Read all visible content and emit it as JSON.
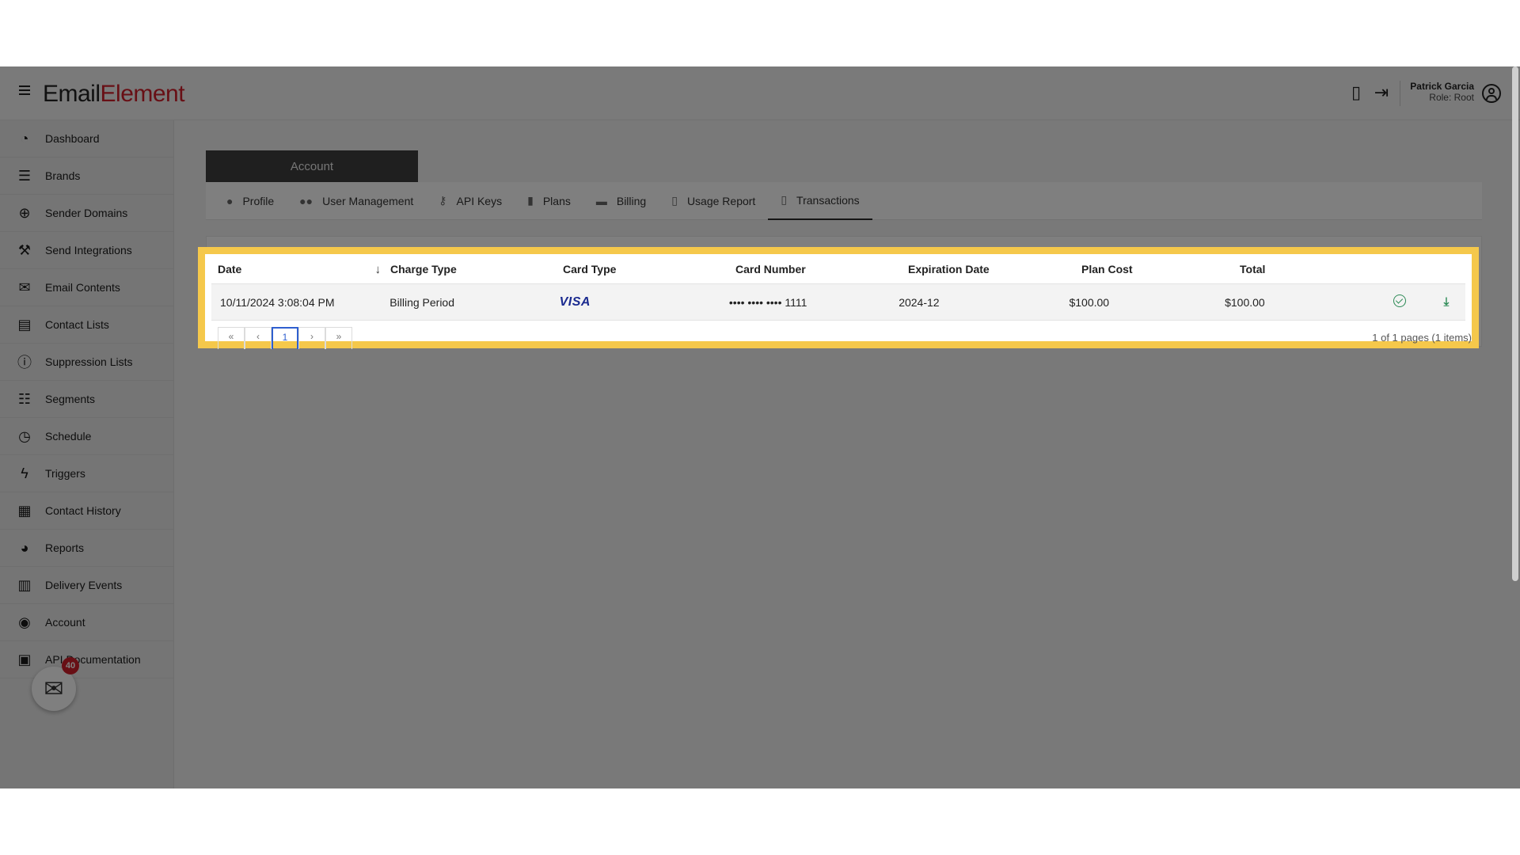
{
  "header": {
    "logo_part1": "Em",
    "logo_part2": "ail",
    "logo_part3": "Element",
    "user_name": "Patrick Garcia",
    "user_role": "Role: Root"
  },
  "sidebar": {
    "items": [
      {
        "label": "Dashboard",
        "icon": "dashboard-icon"
      },
      {
        "label": "Brands",
        "icon": "brands-icon"
      },
      {
        "label": "Sender Domains",
        "icon": "globe-icon"
      },
      {
        "label": "Send Integrations",
        "icon": "wrench-icon"
      },
      {
        "label": "Email Contents",
        "icon": "envelope-icon"
      },
      {
        "label": "Contact Lists",
        "icon": "book-icon"
      },
      {
        "label": "Suppression Lists",
        "icon": "alert-icon"
      },
      {
        "label": "Segments",
        "icon": "segments-icon"
      },
      {
        "label": "Schedule",
        "icon": "clock-icon"
      },
      {
        "label": "Triggers",
        "icon": "bolt-icon"
      },
      {
        "label": "Contact History",
        "icon": "clipboard-icon"
      },
      {
        "label": "Reports",
        "icon": "pie-chart-icon"
      },
      {
        "label": "Delivery Events",
        "icon": "bar-chart-icon"
      },
      {
        "label": "Account",
        "icon": "user-circle-icon"
      },
      {
        "label": "API Documentation",
        "icon": "document-icon"
      }
    ],
    "mail_badge": "40"
  },
  "account": {
    "section_title": "Account",
    "tabs": [
      {
        "label": "Profile",
        "icon": "person-icon"
      },
      {
        "label": "User Management",
        "icon": "users-icon"
      },
      {
        "label": "API Keys",
        "icon": "key-icon"
      },
      {
        "label": "Plans",
        "icon": "plans-icon"
      },
      {
        "label": "Billing",
        "icon": "card-icon"
      },
      {
        "label": "Usage Report",
        "icon": "report-icon"
      },
      {
        "label": "Transactions",
        "icon": "receipt-icon",
        "active": true
      }
    ]
  },
  "grid": {
    "columns": [
      "Date",
      "Charge Type",
      "Card Type",
      "Card Number",
      "Expiration Date",
      "Plan Cost",
      "Total"
    ],
    "rows": [
      {
        "date": "10/11/2024 3:08:04 PM",
        "charge_type": "Billing Period",
        "card_type": "VISA",
        "card_number": "•••• •••• •••• 1111",
        "expiration": "2024-12",
        "plan_cost": "$100.00",
        "total": "$100.00"
      }
    ],
    "pager": {
      "first": "«",
      "prev": "‹",
      "current_page": "1",
      "next": "›",
      "last": "»",
      "info": "1 of 1 pages (1 items)"
    }
  },
  "colors": {
    "highlight": "#f5c84b",
    "brand_red": "#d11f2a",
    "success": "#2e8b57",
    "visa_blue": "#1a2a8f"
  }
}
